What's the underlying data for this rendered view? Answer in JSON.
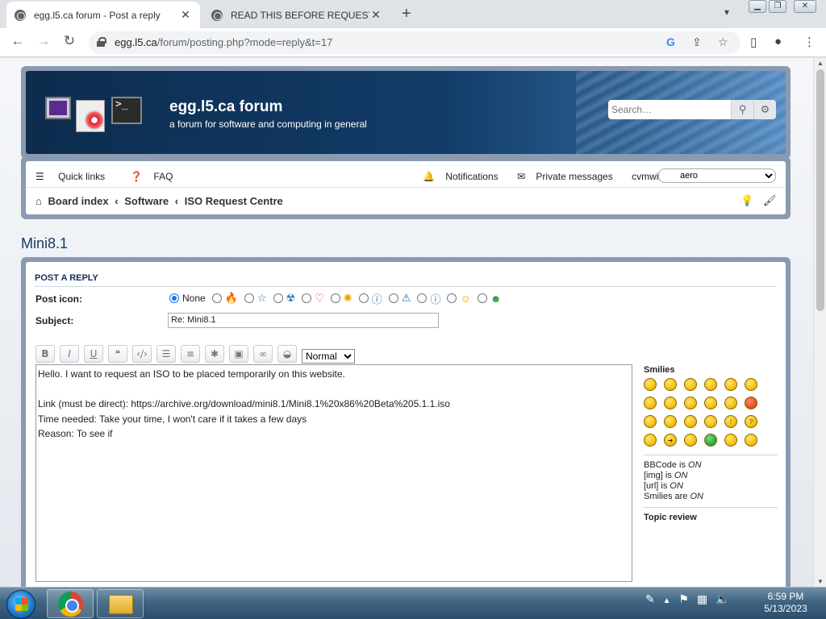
{
  "browser": {
    "tabs": [
      {
        "title": "egg.l5.ca forum - Post a reply",
        "active": true
      },
      {
        "title": "READ THIS BEFORE REQUESTING",
        "active": false
      }
    ],
    "url_host": "egg.l5.ca",
    "url_path": "/forum/posting.php?mode=reply&t=17"
  },
  "site": {
    "title": "egg.l5.ca forum",
    "description": "a forum for software and computing in general",
    "search_placeholder": "Search…"
  },
  "nav": {
    "quick_links": "Quick links",
    "faq": "FAQ",
    "notifications": "Notifications",
    "private_messages": "Private messages",
    "username": "cvmwin7",
    "style_select": "aero",
    "breadcrumbs": [
      "Board index",
      "Software",
      "ISO Request Centre"
    ]
  },
  "topic": {
    "title": "Mini8.1"
  },
  "post": {
    "section_title": "POST A REPLY",
    "post_icon_label": "Post icon:",
    "post_icon_none": "None",
    "subject_label": "Subject:",
    "subject_value": "Re: Mini8.1",
    "font_size_value": "Normal",
    "message_lines": [
      "Hello. I want to request an ISO to be placed temporarily on this website.",
      "",
      "Link (must be direct): https://archive.org/download/mini8.1/Mini8.1%20x86%20Beta%205.1.1.iso",
      "Time needed: Take your time, I won't care if it takes a few days",
      "Reason: To see if "
    ]
  },
  "sidebar": {
    "smilies_title": "Smilies",
    "bbcode_label": "BBCode is",
    "bbcode_state": "ON",
    "img_label": "[img] is",
    "img_state": "ON",
    "url_label": "[url] is",
    "url_state": "ON",
    "smilies_label": "Smilies are",
    "smilies_state": "ON",
    "topic_review": "Topic review"
  },
  "taskbar": {
    "time": "6:59 PM",
    "date": "5/13/2023"
  }
}
